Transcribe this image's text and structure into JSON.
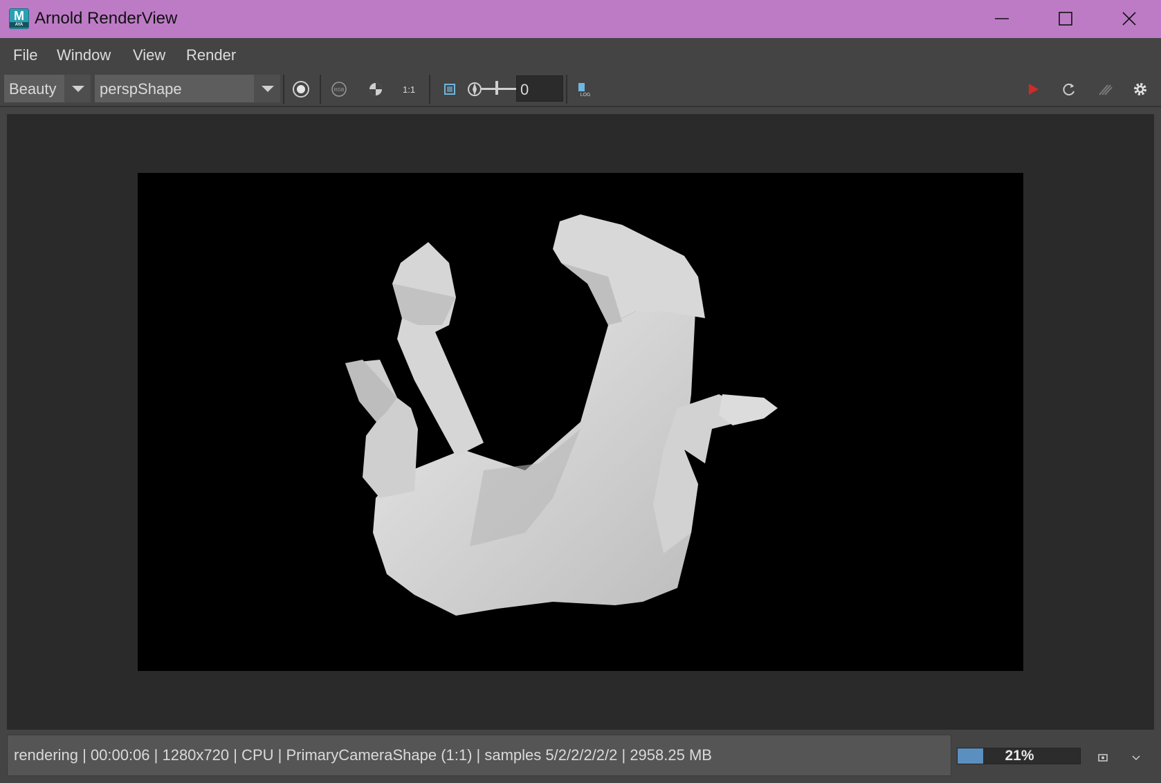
{
  "window": {
    "title": "Arnold RenderView",
    "app_icon_letter": "M",
    "app_icon_sub": "AYA"
  },
  "menu": {
    "items": [
      "File",
      "Window",
      "View",
      "Render"
    ]
  },
  "toolbar": {
    "aov_selected": "Beauty",
    "camera_selected": "perspShape",
    "ratio_label": "1:1",
    "exposure_value": "0",
    "icons": [
      "display-mode-icon",
      "rgb-channel-icon",
      "alpha-channel-icon",
      "ratio-1to1-icon",
      "crop-region-icon",
      "exposure-icon",
      "log-icon",
      "stop-render-icon",
      "refresh-render-icon",
      "interactive-render-icon",
      "settings-gear-icon"
    ],
    "colors": {
      "stop_icon": "#d02a2a",
      "accent": "#5b8fbf"
    }
  },
  "render": {
    "subject": "rendered hand model"
  },
  "status": {
    "text": "rendering | 00:00:06 | 1280x720 | CPU | PrimaryCameraShape (1:1) | samples 5/2/2/2/2/2 | 2958.25 MB",
    "progress_percent": 21,
    "progress_label": "21%"
  }
}
